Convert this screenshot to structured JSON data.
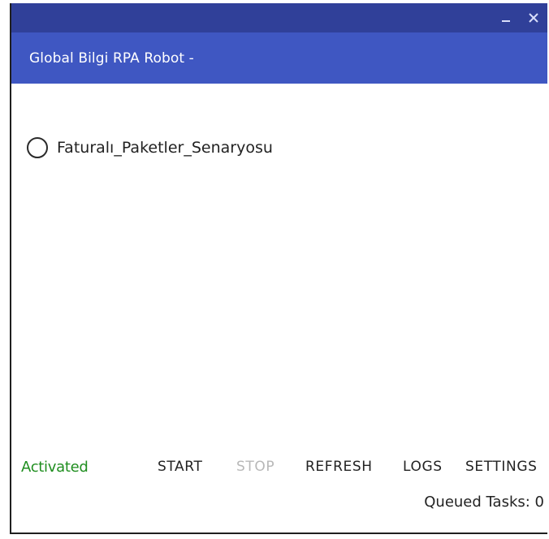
{
  "window": {
    "controls": {
      "minimize_icon": "minimize-icon",
      "close_icon": "close-icon"
    }
  },
  "header": {
    "title": "Global Bilgi RPA Robot -",
    "color": "#3f57c2",
    "strip_color": "#304099"
  },
  "scenarios": [
    {
      "label": "Faturalı_Paketler_Senaryosu",
      "selected": false
    }
  ],
  "footer": {
    "status": "Activated",
    "status_color": "#1f8e1f",
    "buttons": {
      "start": "START",
      "stop": "STOP",
      "refresh": "REFRESH",
      "logs": "LOGS",
      "settings": "SETTINGS"
    },
    "stop_disabled": true,
    "queued_tasks": "Queued Tasks: 0"
  }
}
